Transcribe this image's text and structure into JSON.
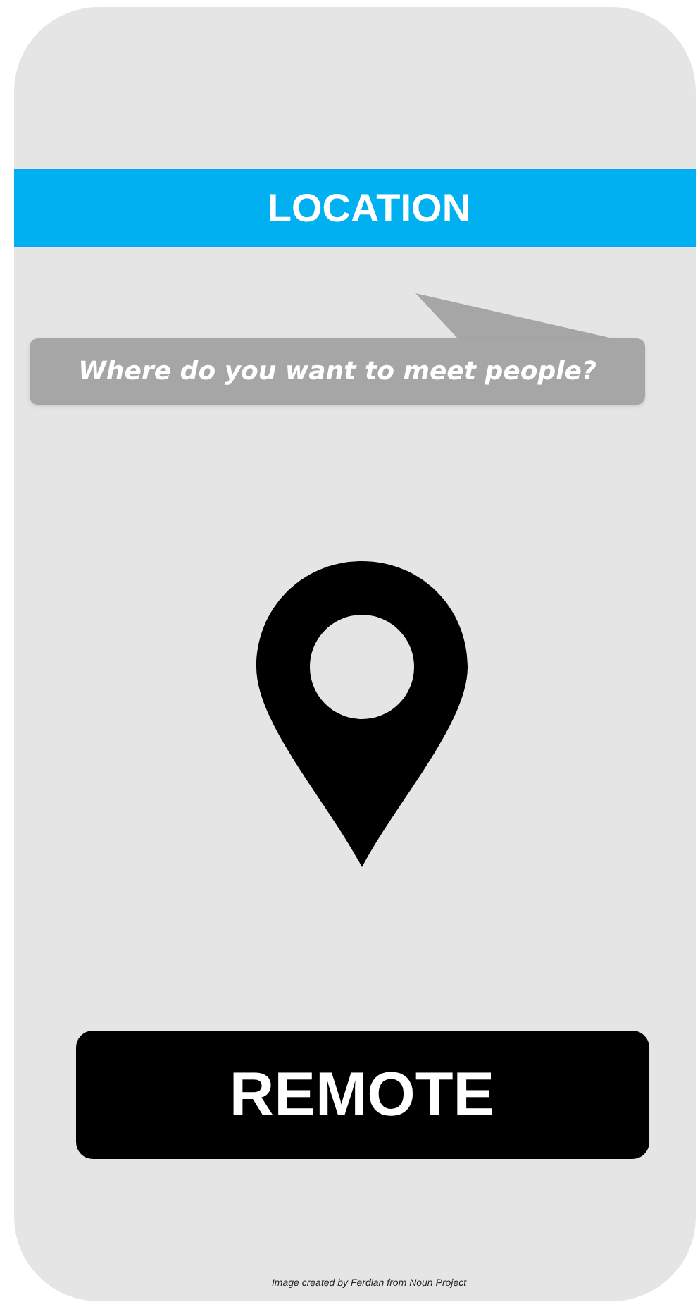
{
  "header": {
    "title": "LOCATION"
  },
  "prompt": {
    "text": "Where do you want to meet people?"
  },
  "button": {
    "label": "REMOTE"
  },
  "credit": {
    "text": "Image created by Ferdian from Noun Project"
  }
}
